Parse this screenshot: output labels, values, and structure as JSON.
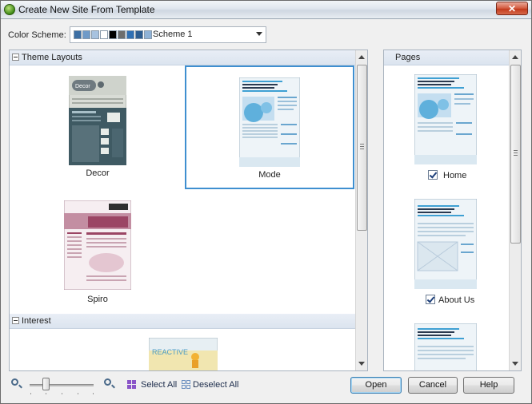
{
  "window": {
    "title": "Create New Site From Template",
    "close_glyph": "✕"
  },
  "color_scheme": {
    "label": "Color Scheme:",
    "value": "Scheme 1",
    "swatch_colors": [
      "#3c6fa4",
      "#6f9ac8",
      "#a7c2df",
      "#ffffff",
      "#000000",
      "#6d6d6d",
      "#2f6fb3",
      "#2c5c90",
      "#8fb2d6"
    ]
  },
  "theme_layouts": {
    "group_label": "Theme Layouts",
    "templates": [
      {
        "name": "Decor"
      },
      {
        "name": "Mode",
        "selected": true
      },
      {
        "name": "Spiro"
      }
    ]
  },
  "interest": {
    "group_label": "Interest",
    "preview_text": "REACTIVE"
  },
  "pages_panel": {
    "header": "Pages",
    "pages": [
      {
        "label": "Home",
        "checked": true
      },
      {
        "label": "About Us",
        "checked": true
      },
      {
        "label": "",
        "checked": true
      }
    ]
  },
  "toolbar": {
    "select_all": "Select All",
    "deselect_all": "Deselect All",
    "zoom_level": 0.25
  },
  "buttons": {
    "open": "Open",
    "cancel": "Cancel",
    "help": "Help"
  },
  "icons": {
    "app": "template-app-icon",
    "zoom_out": "zoom-out-icon",
    "zoom_in": "zoom-in-icon",
    "select_all": "select-all-icon",
    "deselect_all": "deselect-all-icon"
  }
}
